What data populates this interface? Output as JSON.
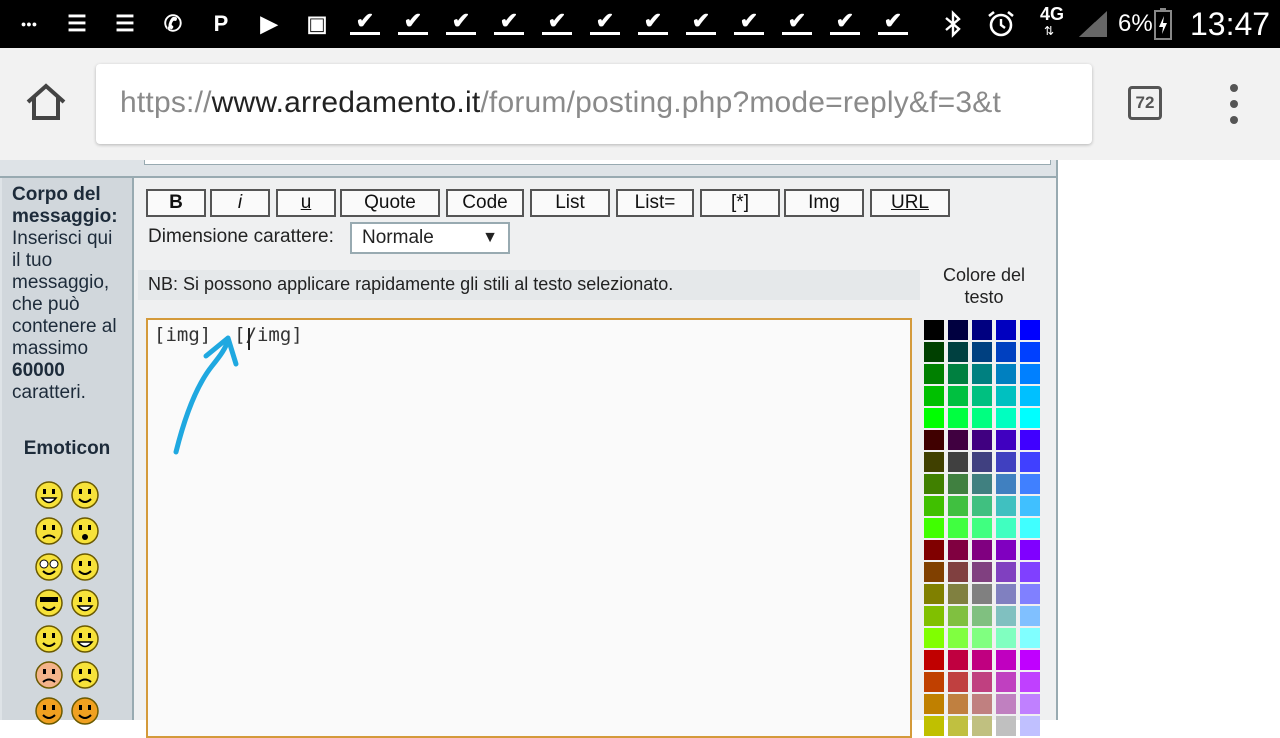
{
  "status_bar": {
    "left_icons": [
      "more-icon",
      "notes-icon",
      "notes-icon",
      "whatsapp-icon",
      "pinterest-icon",
      "youtube-icon",
      "gallery-icon",
      "download-done-icon",
      "download-done-icon",
      "download-done-icon",
      "download-done-icon",
      "download-done-icon",
      "download-done-icon",
      "download-done-icon",
      "download-done-icon",
      "download-done-icon",
      "download-done-icon",
      "download-done-icon",
      "download-done-icon"
    ],
    "right_icons": [
      "bluetooth-icon",
      "alarm-icon",
      "signal-icon",
      "battery-icon"
    ],
    "network": "4G",
    "battery": "6%",
    "time": "13:47"
  },
  "browser": {
    "url_scheme": "https://",
    "url_domain": "www.arredamento.it",
    "url_path": "/forum/posting.php?mode=reply&f=3&t",
    "tab_count": "72"
  },
  "form": {
    "body_title": "Corpo del messaggio:",
    "body_desc_1": "Inserisci qui il tuo messaggio, che può contenere al massimo",
    "body_limit": "60000",
    "body_desc_2": "caratteri.",
    "emoticon_title": "Emoticon",
    "buttons": [
      "B",
      "i",
      "u",
      "Quote",
      "Code",
      "List",
      "List=",
      "[*]",
      "Img",
      "URL"
    ],
    "font_size_label": "Dimensione carattere:",
    "font_size_value": "Normale",
    "hint": "NB: Si possono applicare rapidamente gli stili al testo selezionato.",
    "message_value": "[img]  [/img]",
    "color_title": "Colore del testo"
  },
  "colors": {
    "panel": "#dee3e7",
    "left_panel": "#d1d7dc",
    "border": "#98aab1",
    "textarea_border": "#d49a3a",
    "annotation_arrow": "#1fa8e0"
  }
}
